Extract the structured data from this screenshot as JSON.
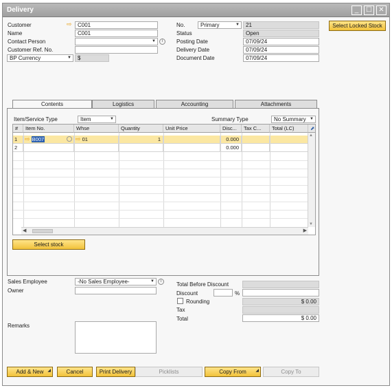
{
  "window": {
    "title": "Delivery",
    "minimize": "_",
    "maximize": "☐",
    "close": "✕"
  },
  "header_left": {
    "customer_label": "Customer",
    "customer_value": "C001",
    "name_label": "Name",
    "name_value": "C001",
    "contact_label": "Contact Person",
    "contact_value": "",
    "ref_label": "Customer Ref. No.",
    "ref_value": "",
    "currency_select": "BP Currency",
    "currency_symbol": "$"
  },
  "header_right": {
    "no_label": "No.",
    "series_value": "Primary",
    "no_value": "21",
    "status_label": "Status",
    "status_value": "Open",
    "posting_label": "Posting Date",
    "posting_value": "07/09/24",
    "delivery_label": "Delivery Date",
    "delivery_value": "07/09/24",
    "document_label": "Document Date",
    "document_value": "07/09/24"
  },
  "locked_stock_button": "Select Locked Stock",
  "tabs": [
    "Contents",
    "Logistics",
    "Accounting",
    "Attachments"
  ],
  "contents": {
    "item_type_label": "Item/Service Type",
    "item_type_value": "Item",
    "summary_label": "Summary Type",
    "summary_value": "No Summary",
    "columns": [
      "#",
      "Item No.",
      "Whse",
      "Quantity",
      "Unit Price",
      "Disc...",
      "Tax C...",
      "Total (LC)"
    ],
    "rows": [
      {
        "num": "1",
        "item": "B007",
        "whse": "01",
        "qty": "1",
        "price": "",
        "disc": "0.000",
        "tax": "",
        "total": ""
      },
      {
        "num": "2",
        "item": "",
        "whse": "",
        "qty": "",
        "price": "",
        "disc": "0.000",
        "tax": "",
        "total": ""
      }
    ],
    "select_stock_button": "Select stock"
  },
  "footer_left": {
    "sales_employee_label": "Sales Employee",
    "sales_employee_value": "-No Sales Employee-",
    "owner_label": "Owner",
    "owner_value": "",
    "remarks_label": "Remarks",
    "remarks_value": ""
  },
  "totals": {
    "before_discount_label": "Total Before Discount",
    "before_discount_value": "",
    "discount_label": "Discount",
    "discount_pct": "",
    "percent_sign": "%",
    "discount_value": "",
    "rounding_label": "Rounding",
    "rounding_value": "$ 0.00",
    "tax_label": "Tax",
    "tax_value": "",
    "total_label": "Total",
    "total_value": "$ 0.00"
  },
  "buttons": {
    "add_new": "Add & New",
    "cancel": "Cancel",
    "print_delivery": "Print Delivery",
    "picklists": "Picklists",
    "copy_from": "Copy From",
    "copy_to": "Copy To"
  },
  "colors": {
    "accent": "#f2c23a",
    "title_bar": "#a9a9a9",
    "selected_row": "#fbe7a2"
  }
}
